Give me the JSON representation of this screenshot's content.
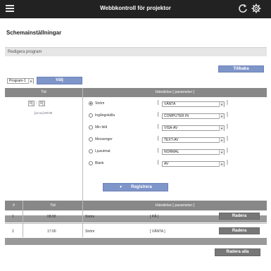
{
  "header": {
    "title": "Webbkontroll för projektor",
    "menu_icon": "hamburger-menu-icon",
    "refresh_icon": "refresh-icon",
    "settings_icon": "gear-icon"
  },
  "page": {
    "title": "Schemainställningar"
  },
  "panel": {
    "title": "Redigera program"
  },
  "actions": {
    "back_label": "Tillbaka",
    "select_label": "Välj",
    "register_label": "Registrera",
    "delete_all_label": "Radera alla"
  },
  "program_select": {
    "value": "Program-1"
  },
  "editor": {
    "col_time": "Tid",
    "col_event": "Händelse [ parameter ]",
    "hour": "0",
    "minute": "0",
    "time_hint": "[xx:xx] 00:00",
    "events": [
      {
        "label": "Ström",
        "value": "VÄNTA",
        "selected": true
      },
      {
        "label": "Ingångskälla",
        "value": "COMPUTER IN",
        "selected": false
      },
      {
        "label": "Min bild",
        "value": "VISA-AV",
        "selected": false
      },
      {
        "label": "Messenger",
        "value": "TEXT-AV",
        "selected": false
      },
      {
        "label": "Ljusutmat",
        "value": "NORMAL",
        "selected": false
      },
      {
        "label": "Blank",
        "value": "AV",
        "selected": false
      }
    ],
    "bracket_open": "[",
    "bracket_close": "]"
  },
  "schedule": {
    "col_num": "#",
    "col_time": "Tid",
    "col_event": "Händelse [ parameter ]",
    "delete_label": "Radera",
    "rows": [
      {
        "num": "1",
        "time": "08:00",
        "event": "Ström",
        "param": "[ PÅ ]"
      },
      {
        "num": "2",
        "time": "17:00",
        "event": "Ström",
        "param": "[ VÄNTA ]"
      }
    ]
  },
  "colors": {
    "topbar": "#222222",
    "button_blue": "#7e95c9",
    "button_gray": "#777777",
    "table_header": "#888888"
  }
}
